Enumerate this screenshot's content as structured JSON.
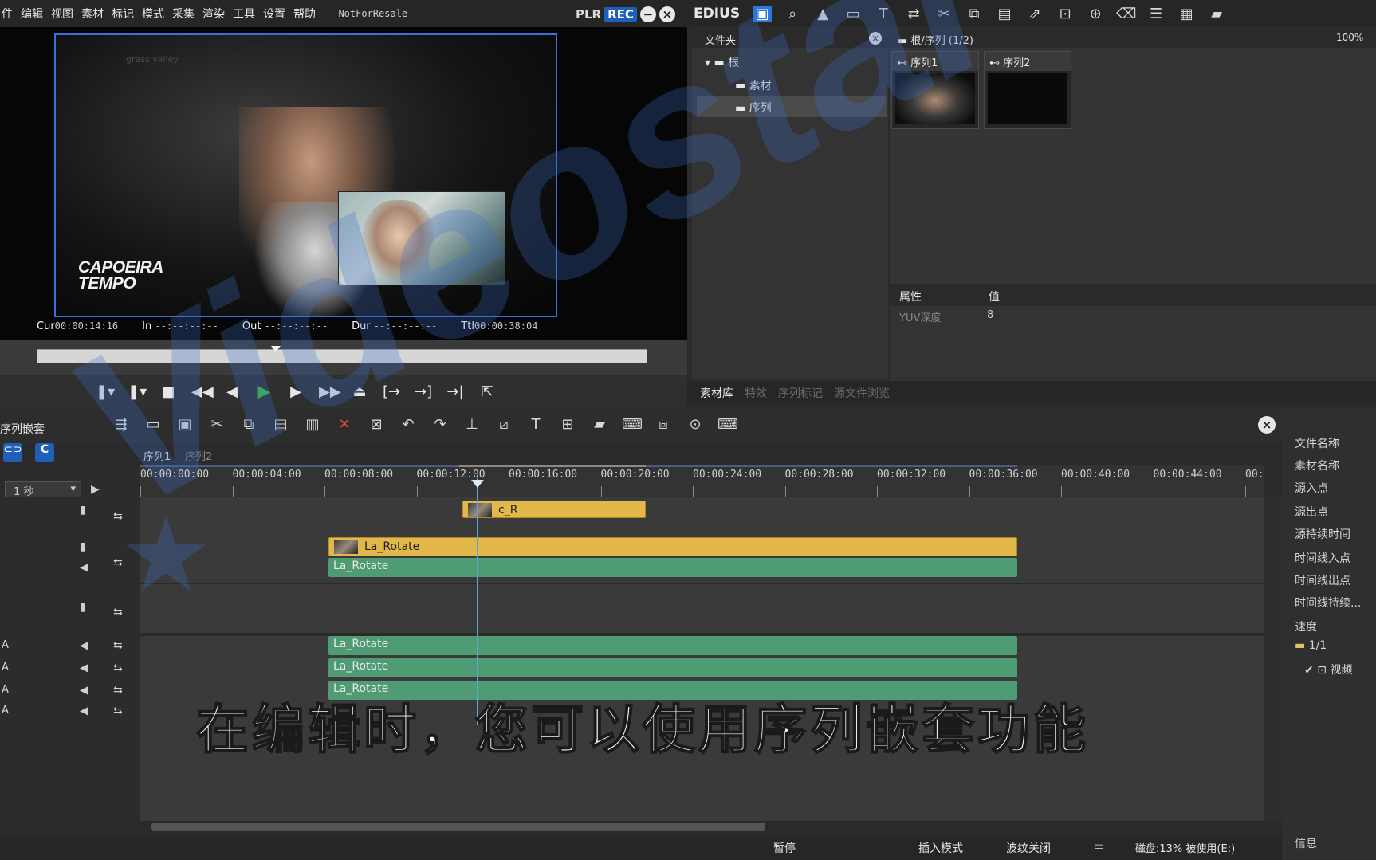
{
  "menu": [
    "件",
    "编辑",
    "视图",
    "素材",
    "标记",
    "模式",
    "采集",
    "渲染",
    "工具",
    "设置",
    "帮助"
  ],
  "menu_suffix": "- NotForResale -",
  "player": {
    "plr": "PLR",
    "rec": "REC",
    "minimize": "−",
    "close": "×",
    "brand_overlay_line1": "CAPOEIRA",
    "brand_overlay_line2": "TEMPO",
    "gv_logo": "grass valley"
  },
  "timecodes": {
    "cur_label": "Cur",
    "cur_value": "00:00:14:16",
    "in_label": "In",
    "in_value": "--:--:--:--",
    "out_label": "Out",
    "out_value": "--:--:--:--",
    "dur_label": "Dur",
    "dur_value": "--:--:--:--",
    "ttl_label": "Ttl",
    "ttl_value": "00:00:38:04"
  },
  "transport": [
    "❚▾",
    "❚▾",
    "■",
    "◀◀",
    "◀",
    "▶",
    "▶",
    "▶▶",
    "⏏",
    "[→",
    "→]",
    "→|",
    "⇱"
  ],
  "app": {
    "brand": "EDIUS"
  },
  "folder_panel": {
    "title": "文件夹",
    "tree": [
      {
        "label": "根"
      },
      {
        "label": "素材"
      },
      {
        "label": "序列"
      }
    ]
  },
  "bin": {
    "path": "根/序列 (1/2)",
    "zoom": "100%",
    "clips": [
      {
        "label": "序列1"
      },
      {
        "label": "序列2"
      }
    ]
  },
  "properties": {
    "col_attr": "属性",
    "col_val": "值",
    "rows": [
      {
        "attr": "YUV深度",
        "val": "8"
      }
    ]
  },
  "bin_tabs": [
    "素材库",
    "特效",
    "序列标记",
    "源文件浏览"
  ],
  "timeline": {
    "seq_label": "序列嵌套",
    "tabs": [
      "序列1",
      "序列2"
    ],
    "scale": "1 秒",
    "ticks": [
      "00:00:00:00",
      "00:00:04:00",
      "00:00:08:00",
      "00:00:12:00",
      "00:00:16:00",
      "00:00:20:00",
      "00:00:24:00",
      "00:00:28:00",
      "00:00:32:00",
      "00:00:36:00",
      "00:00:40:00",
      "00:00:44:00",
      "00:"
    ],
    "clips": {
      "top": "c_R",
      "video": "La_Rotate",
      "audio1": "La_Rotate",
      "audio2": "La_Rotate",
      "audio3": "La_Rotate",
      "audio4": "La_Rotate"
    },
    "track_labels": [
      "A",
      "A",
      "A",
      "A"
    ]
  },
  "status": {
    "pause": "暂停",
    "insert_mode": "插入模式",
    "ripple": "波纹关闭",
    "disk": "磁盘:13% 被使用(E:)"
  },
  "info_panel": {
    "rows": [
      "文件名称",
      "素材名称",
      "源入点",
      "源出点",
      "源持续时间",
      "时间线入点",
      "时间线出点",
      "时间线持续...",
      "速度"
    ],
    "counter": "1/1",
    "video_label": "视频",
    "footer": "信息"
  },
  "subtitle": "在编辑时，您可以使用序列嵌套功能",
  "watermark": "Videostar"
}
